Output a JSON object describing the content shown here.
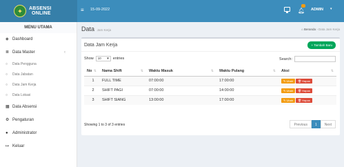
{
  "app": {
    "logo_line1": "ABSENSI",
    "logo_line2": "ONLINE",
    "date": "15-09-2022",
    "user": "ADMIN"
  },
  "sidebar": {
    "header": "MENU UTAMA",
    "items": [
      {
        "label": "Dashboard",
        "icon": "dashboard-icon"
      },
      {
        "label": "Data Master",
        "icon": "database-icon"
      },
      {
        "label": "Data Pengguna",
        "icon": "circle-icon"
      },
      {
        "label": "Data Jabatan",
        "icon": "circle-icon"
      },
      {
        "label": "Data Jam Kerja",
        "icon": "circle-icon"
      },
      {
        "label": "Data Lokasi",
        "icon": "circle-icon"
      },
      {
        "label": "Data Absensi",
        "icon": "calendar-icon"
      },
      {
        "label": "Pengaturan",
        "icon": "gears-icon"
      },
      {
        "label": "Administrator",
        "icon": "user-icon"
      },
      {
        "label": "Keluar",
        "icon": "sign-out-icon"
      }
    ]
  },
  "header": {
    "title": "Data",
    "subtitle": "Jam Kerja",
    "crumb_home": "Beranda",
    "crumb_current": "Data Jam Kerja"
  },
  "box": {
    "title": "Data Jam Kerja",
    "add_button": "+ Tambah Baru",
    "show_label": "Show",
    "show_value": "10",
    "entries_label": "entries",
    "search_label": "Search:",
    "columns": [
      "No",
      "Nama Shift",
      "Waktu Masuk",
      "Waktu Pulang",
      "Aksi"
    ],
    "rows": [
      {
        "no": "1",
        "nama": "FULL TIME",
        "masuk": "07:00:00",
        "pulang": "17:00:00"
      },
      {
        "no": "2",
        "nama": "SHIFT PAGI",
        "masuk": "07:00:00",
        "pulang": "14:00:00"
      },
      {
        "no": "3",
        "nama": "SHIFT SIANG",
        "masuk": "13:00:00",
        "pulang": "17:00:00"
      }
    ],
    "edit_label": "Ubah",
    "delete_label": "Hapus",
    "info": "Showing 1 to 3 of 3 entries",
    "prev": "Previous",
    "page": "1",
    "next": "Next"
  },
  "colors": {
    "topbar": "#3c8dbc",
    "success": "#00a65a",
    "warning": "#f39c12",
    "danger": "#dd4b39"
  }
}
